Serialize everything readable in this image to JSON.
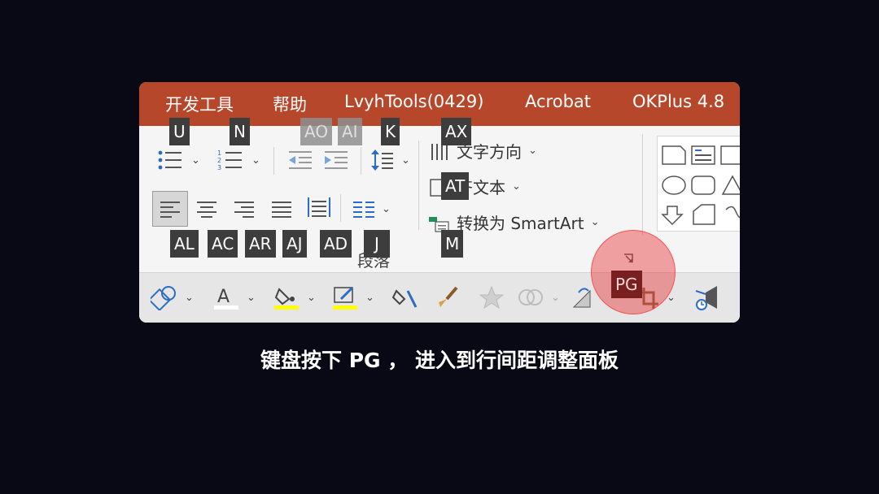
{
  "menubar": {
    "items": [
      "开发工具",
      "帮助",
      "LvyhTools(0429)",
      "Acrobat",
      "OKPlus 4.8"
    ]
  },
  "ribbon": {
    "commands": {
      "text_direction": "文字方向",
      "align_text": "齐文本",
      "convert_smartart": "转换为 SmartArt"
    },
    "group_label": "段落",
    "chevron": "⌄"
  },
  "keytips": {
    "bullets": "U",
    "numbering": "N",
    "decrease_indent": "AO",
    "increase_indent": "AI",
    "line_spacing": "K",
    "text_direction": "AX",
    "align_text": "AT",
    "align_left": "AL",
    "align_center": "AC",
    "align_right": "AR",
    "justify": "AJ",
    "distributed": "AD",
    "columns": "J",
    "smartart": "M",
    "paragraph_dialog": "PG"
  },
  "colors": {
    "menubar_bg": "#b7472a",
    "highlight": "#e82828",
    "keytip_bg": "#3d3d3d",
    "font_color_bar": "#ffff00"
  },
  "caption": "键盘按下 PG ， 进入到行间距调整面板"
}
